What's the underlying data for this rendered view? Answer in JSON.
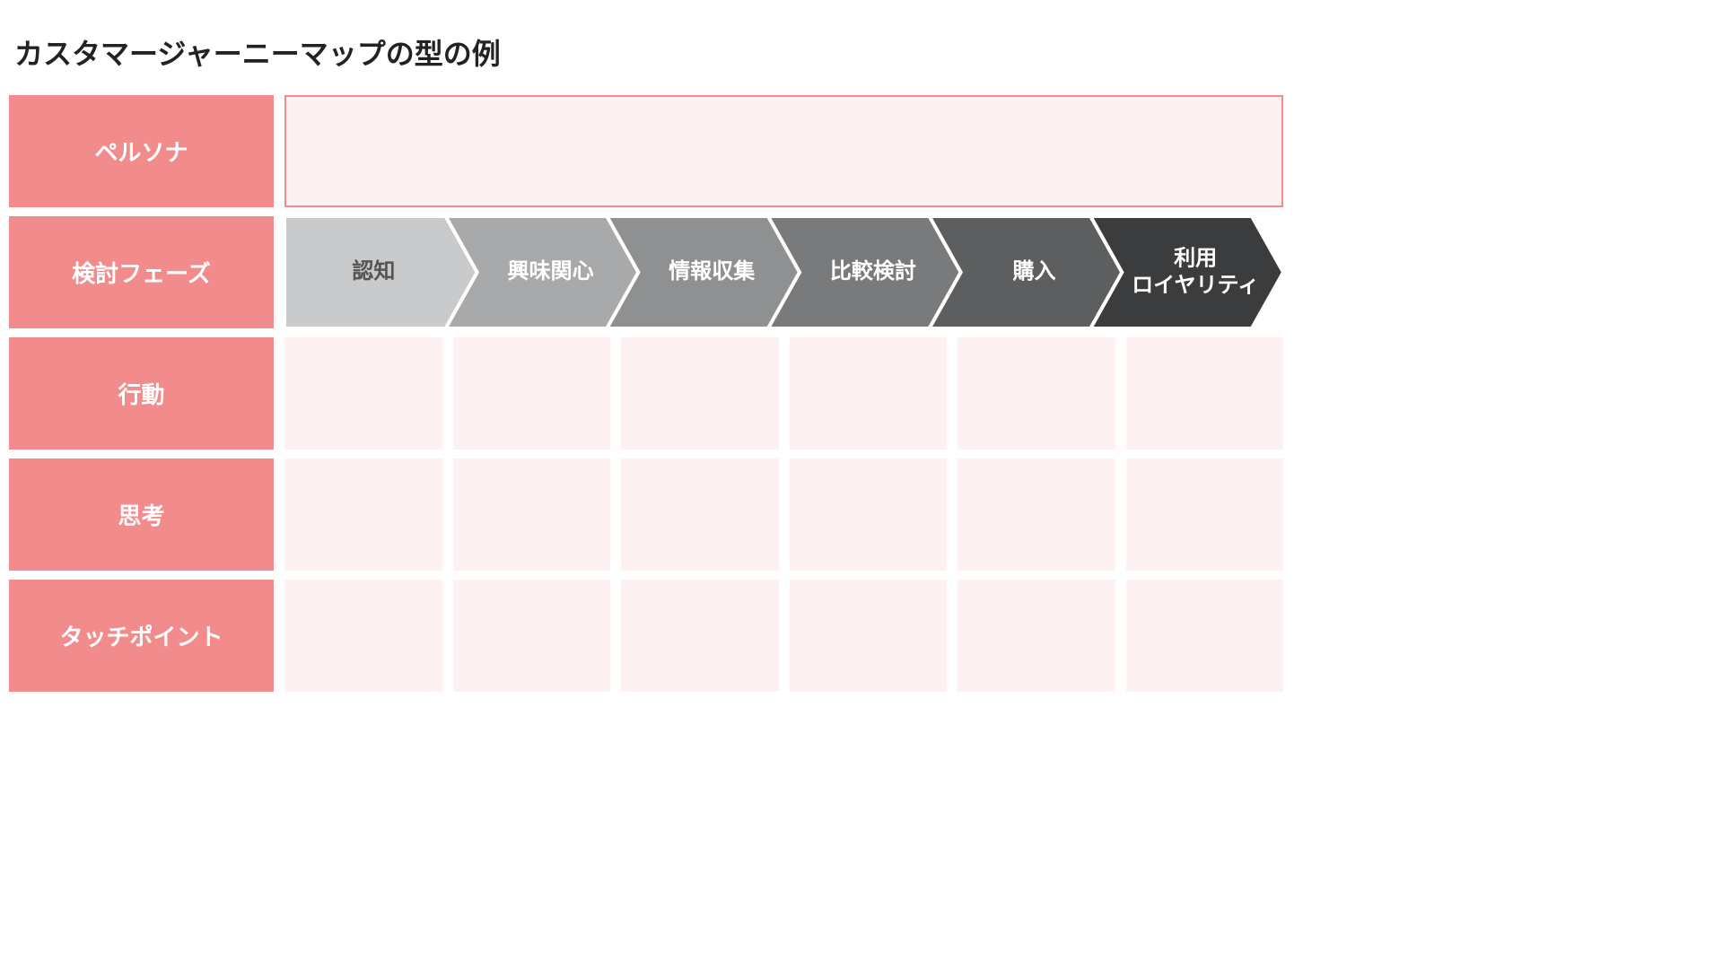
{
  "title": "カスタマージャーニーマップの型の例",
  "rows": {
    "persona": "ペルソナ",
    "phase": "検討フェーズ",
    "action": "行動",
    "thought": "思考",
    "touchpoint": "タッチポイント"
  },
  "phases": [
    {
      "label": "認知",
      "fill": "#c9cacb"
    },
    {
      "label": "興味関心",
      "fill": "#a8a9aa"
    },
    {
      "label": "情報収集",
      "fill": "#8f9091"
    },
    {
      "label": "比較検討",
      "fill": "#797a7b"
    },
    {
      "label": "購入",
      "fill": "#5d5e5f"
    },
    {
      "label": "利用\nロイヤリティ",
      "fill": "#3b3c3d"
    }
  ],
  "colors": {
    "accent": "#f28b8b",
    "cellBg": "#fdf1f1"
  }
}
